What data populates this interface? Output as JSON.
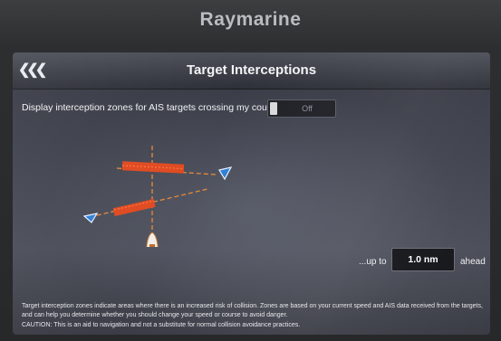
{
  "device": {
    "brand": "Raymarine"
  },
  "header": {
    "title": "Target Interceptions",
    "back_icon": "triple-chevron-left-icon"
  },
  "option": {
    "label": "Display interception zones for AIS targets crossing my course",
    "toggle_value": "Off"
  },
  "range": {
    "prefix": "...up to",
    "value": "1.0 nm",
    "suffix": "ahead"
  },
  "info_text": "Target interception zones indicate areas where there is an increased risk of collision. Zones are based on your current speed and AIS data received from the targets, and can help you determine whether you should change your speed or course to avoid danger.",
  "caution_text": "CAUTION: This is an aid to navigation and not a substitute for normal collision avoidance practices.",
  "colors": {
    "zone": "#e04a21",
    "target": "#2f7fd6",
    "course_line": "#e8893a",
    "vessel": "#f0efe9"
  }
}
